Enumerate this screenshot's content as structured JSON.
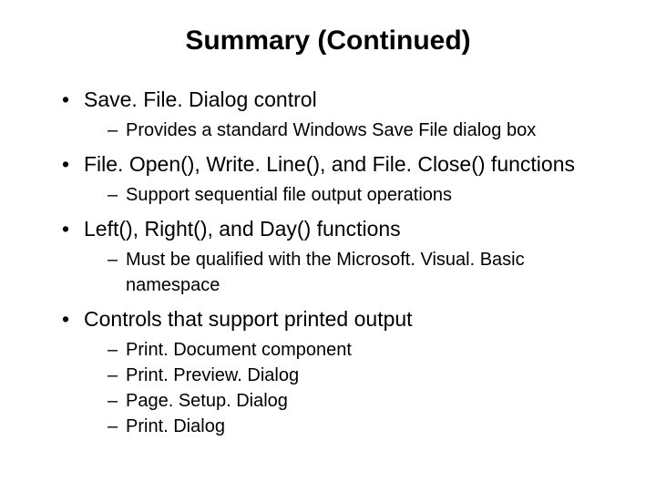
{
  "title": "Summary (Continued)",
  "bullets": [
    {
      "text": "Save. File. Dialog control",
      "sub": [
        "Provides a standard Windows Save File dialog box"
      ]
    },
    {
      "text": "File. Open(), Write. Line(), and File. Close() functions",
      "sub": [
        "Support sequential file output operations"
      ]
    },
    {
      "text": "Left(), Right(), and Day() functions",
      "sub": [
        "Must be qualified with the Microsoft. Visual. Basic namespace"
      ]
    },
    {
      "text": "Controls that support printed output",
      "sub": [
        "Print. Document component",
        "Print. Preview. Dialog",
        "Page. Setup. Dialog",
        "Print. Dialog"
      ]
    }
  ]
}
